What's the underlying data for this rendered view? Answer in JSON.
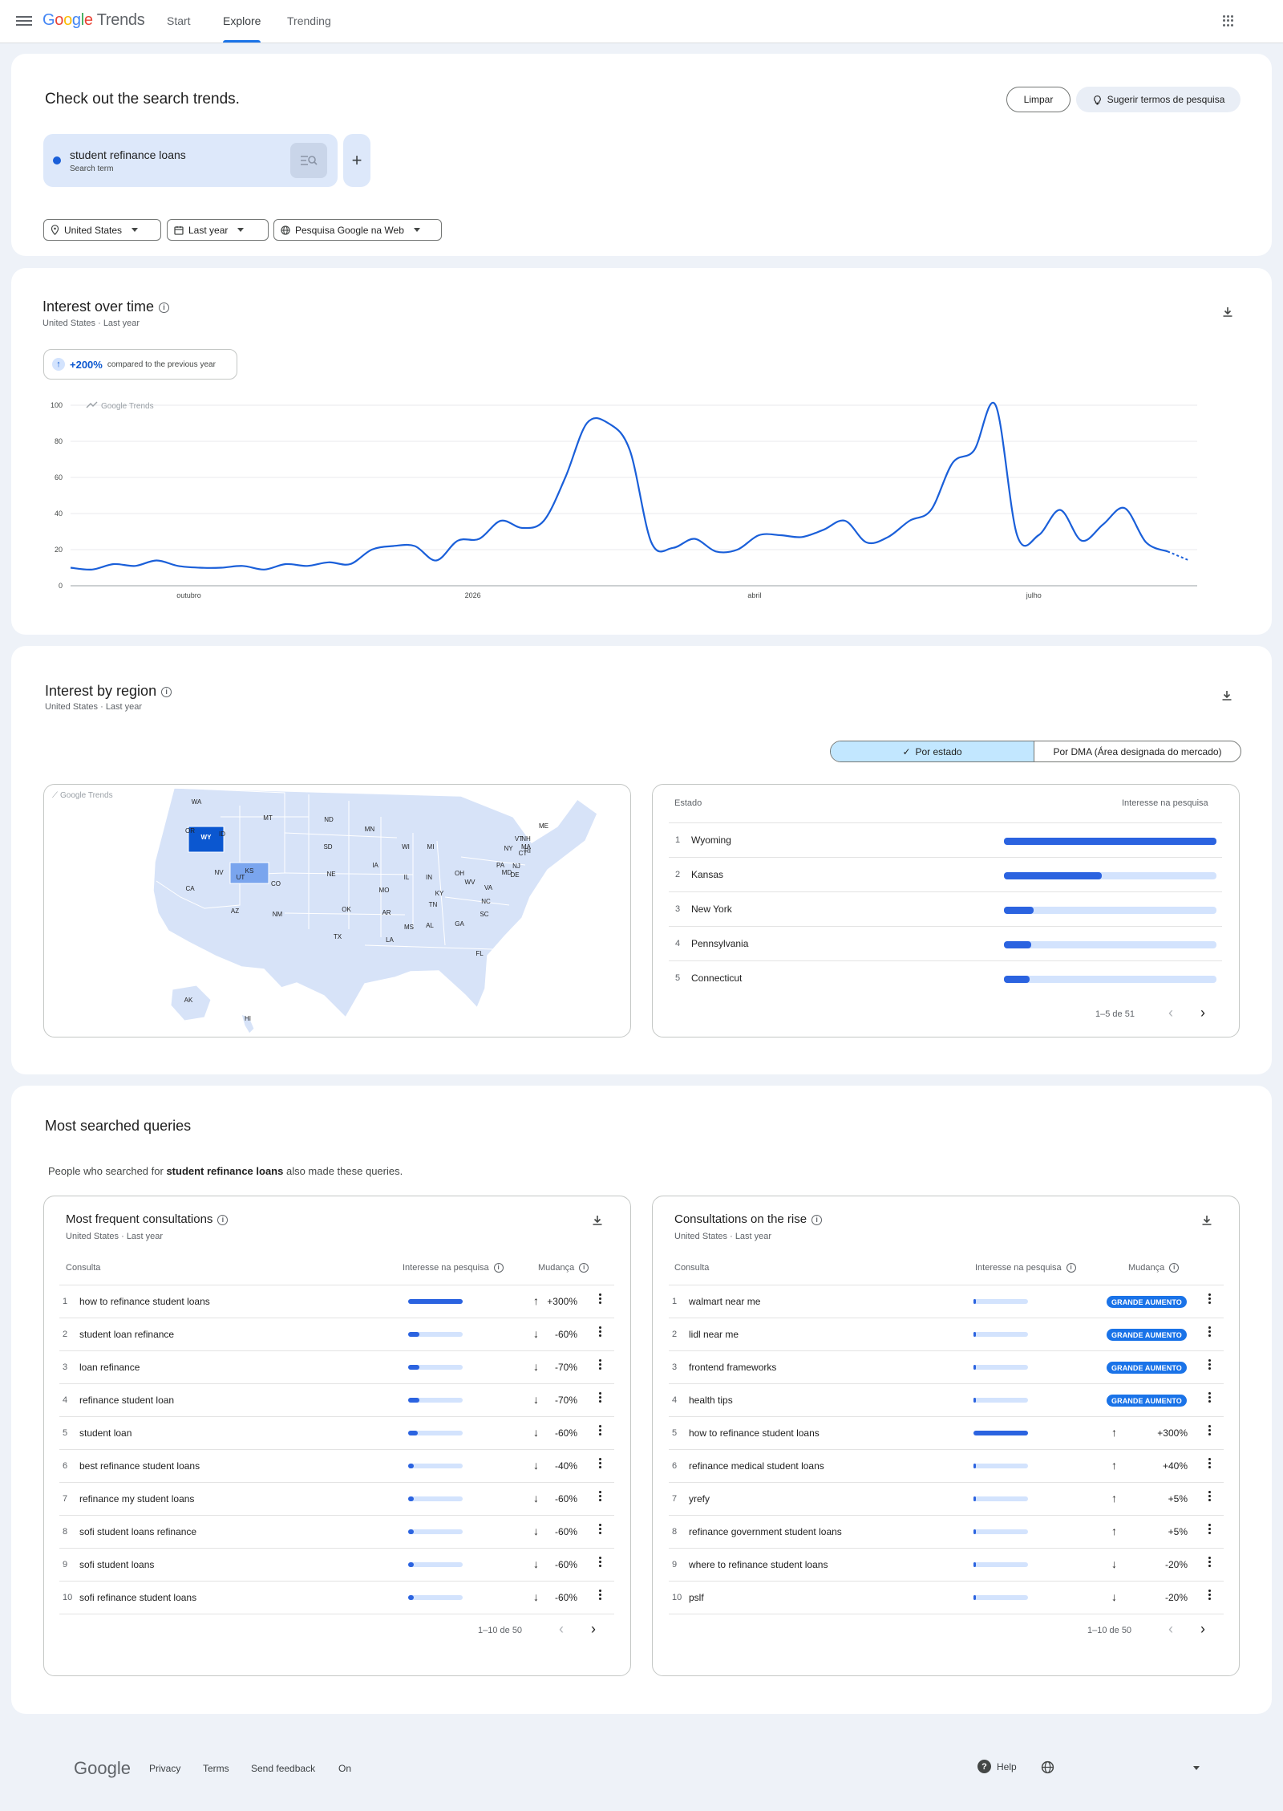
{
  "header": {
    "logo_google": "Google",
    "logo_trends": "Trends",
    "tabs": [
      "Start",
      "Explore",
      "Trending"
    ]
  },
  "search": {
    "title": "Check out the search trends.",
    "clear_label": "Limpar",
    "suggest_label": "Sugerir termos de pesquisa",
    "term": "student refinance loans",
    "term_type": "Search term",
    "filters": [
      "United States",
      "Last year",
      "Pesquisa Google na Web"
    ],
    "term_color": "#1a5fd9"
  },
  "time": {
    "title": "Interest over time",
    "subtitle": "United States  ·  Last year",
    "change_pct": "+200%",
    "change_text": "compared to the previous year",
    "watermark": "Google Trends"
  },
  "chart_data": {
    "type": "line",
    "y_ticks": [
      0,
      20,
      40,
      60,
      80,
      100
    ],
    "ylim": [
      0,
      100
    ],
    "x_tick_labels": [
      "outubro",
      "2026",
      "abril",
      "julho"
    ],
    "series": [
      {
        "values": [
          10,
          9,
          12,
          11,
          14,
          11,
          10,
          10,
          11,
          9,
          12,
          11,
          13,
          12,
          20,
          22,
          22,
          14,
          25,
          26,
          36,
          32,
          36,
          60,
          90,
          90,
          75,
          24,
          21,
          26,
          19,
          20,
          28,
          28,
          27,
          31,
          36,
          24,
          27,
          36,
          42,
          68,
          75,
          100,
          28,
          28,
          42,
          25,
          34,
          43,
          24,
          19,
          14
        ],
        "last_point_partial": true
      }
    ]
  },
  "region": {
    "title": "Interest by region",
    "subtitle": "United States  ·  Last year",
    "toggle_state": "Por estado",
    "toggle_dma": "Por DMA (Área designada do mercado)",
    "watermark": "Google Trends",
    "col_state": "Estado",
    "col_interest": "Interesse na pesquisa",
    "rows": [
      {
        "rank": "1",
        "name": "Wyoming",
        "value": 100
      },
      {
        "rank": "2",
        "name": "Kansas",
        "value": 46
      },
      {
        "rank": "3",
        "name": "New York",
        "value": 14
      },
      {
        "rank": "4",
        "name": "Pennsylvania",
        "value": 13
      },
      {
        "rank": "5",
        "name": "Connecticut",
        "value": 12
      }
    ],
    "pager": "1–5 de 51",
    "map_labels": [
      "WA",
      "OR",
      "CA",
      "ID",
      "NV",
      "MT",
      "WY",
      "UT",
      "AZ",
      "CO",
      "NM",
      "ND",
      "SD",
      "NE",
      "KS",
      "OK",
      "TX",
      "MN",
      "IA",
      "MO",
      "AR",
      "LA",
      "WI",
      "IL",
      "MS",
      "MI",
      "IN",
      "KY",
      "TN",
      "AL",
      "OH",
      "GA",
      "FL",
      "SC",
      "NC",
      "VA",
      "WV",
      "PA",
      "MD",
      "DE",
      "NJ",
      "NY",
      "CT",
      "RI",
      "MA",
      "VT",
      "NH",
      "ME",
      "AK",
      "HI"
    ]
  },
  "queries": {
    "title": "Most searched queries",
    "intro_before": "People who searched for ",
    "intro_term": "student refinance loans",
    "intro_after": " also made these queries.",
    "left": {
      "title": "Most frequent consultations",
      "subtitle": "United States  ·  Last year",
      "col_query": "Consulta",
      "col_interest": "Interesse na pesquisa",
      "col_change": "Mudança",
      "rows": [
        {
          "rank": "1",
          "q": "how to refinance student loans",
          "value": 100,
          "dir": "up",
          "change": "+300%"
        },
        {
          "rank": "2",
          "q": "student loan refinance",
          "value": 21,
          "dir": "down",
          "change": "-60%"
        },
        {
          "rank": "3",
          "q": "loan refinance",
          "value": 21,
          "dir": "down",
          "change": "-70%"
        },
        {
          "rank": "4",
          "q": "refinance student loan",
          "value": 21,
          "dir": "down",
          "change": "-70%"
        },
        {
          "rank": "5",
          "q": "student loan",
          "value": 17,
          "dir": "down",
          "change": "-60%"
        },
        {
          "rank": "6",
          "q": "best refinance student loans",
          "value": 11,
          "dir": "down",
          "change": "-40%"
        },
        {
          "rank": "7",
          "q": "refinance my student loans",
          "value": 11,
          "dir": "down",
          "change": "-60%"
        },
        {
          "rank": "8",
          "q": "sofi student loans refinance",
          "value": 11,
          "dir": "down",
          "change": "-60%"
        },
        {
          "rank": "9",
          "q": "sofi student loans",
          "value": 11,
          "dir": "down",
          "change": "-60%"
        },
        {
          "rank": "10",
          "q": "sofi refinance student loans",
          "value": 11,
          "dir": "down",
          "change": "-60%"
        }
      ],
      "pager": "1–10 de 50"
    },
    "right": {
      "title": "Consultations on the rise",
      "subtitle": "United States  ·  Last year",
      "col_query": "Consulta",
      "col_interest": "Interesse na pesquisa",
      "col_change": "Mudança",
      "rows": [
        {
          "rank": "1",
          "q": "walmart near me",
          "value": 4,
          "dir": "",
          "change": "GRANDE AUMENTO",
          "badge": true
        },
        {
          "rank": "2",
          "q": "lidl near me",
          "value": 4,
          "dir": "",
          "change": "GRANDE AUMENTO",
          "badge": true
        },
        {
          "rank": "3",
          "q": "frontend frameworks",
          "value": 4,
          "dir": "",
          "change": "GRANDE AUMENTO",
          "badge": true
        },
        {
          "rank": "4",
          "q": "health tips",
          "value": 4,
          "dir": "",
          "change": "GRANDE AUMENTO",
          "badge": true
        },
        {
          "rank": "5",
          "q": "how to refinance student loans",
          "value": 100,
          "dir": "up",
          "change": "+300%"
        },
        {
          "rank": "6",
          "q": "refinance medical student loans",
          "value": 4,
          "dir": "up",
          "change": "+40%"
        },
        {
          "rank": "7",
          "q": "yrefy",
          "value": 4,
          "dir": "up",
          "change": "+5%"
        },
        {
          "rank": "8",
          "q": "refinance government student loans",
          "value": 4,
          "dir": "up",
          "change": "+5%"
        },
        {
          "rank": "9",
          "q": "where to refinance student loans",
          "value": 4,
          "dir": "down",
          "change": "-20%"
        },
        {
          "rank": "10",
          "q": "pslf",
          "value": 4,
          "dir": "down",
          "change": "-20%"
        }
      ],
      "pager": "1–10 de 50"
    }
  },
  "footer": {
    "logo": "Google",
    "links": [
      "Privacy",
      "Terms",
      "Send feedback",
      "On"
    ],
    "help": "Help"
  }
}
